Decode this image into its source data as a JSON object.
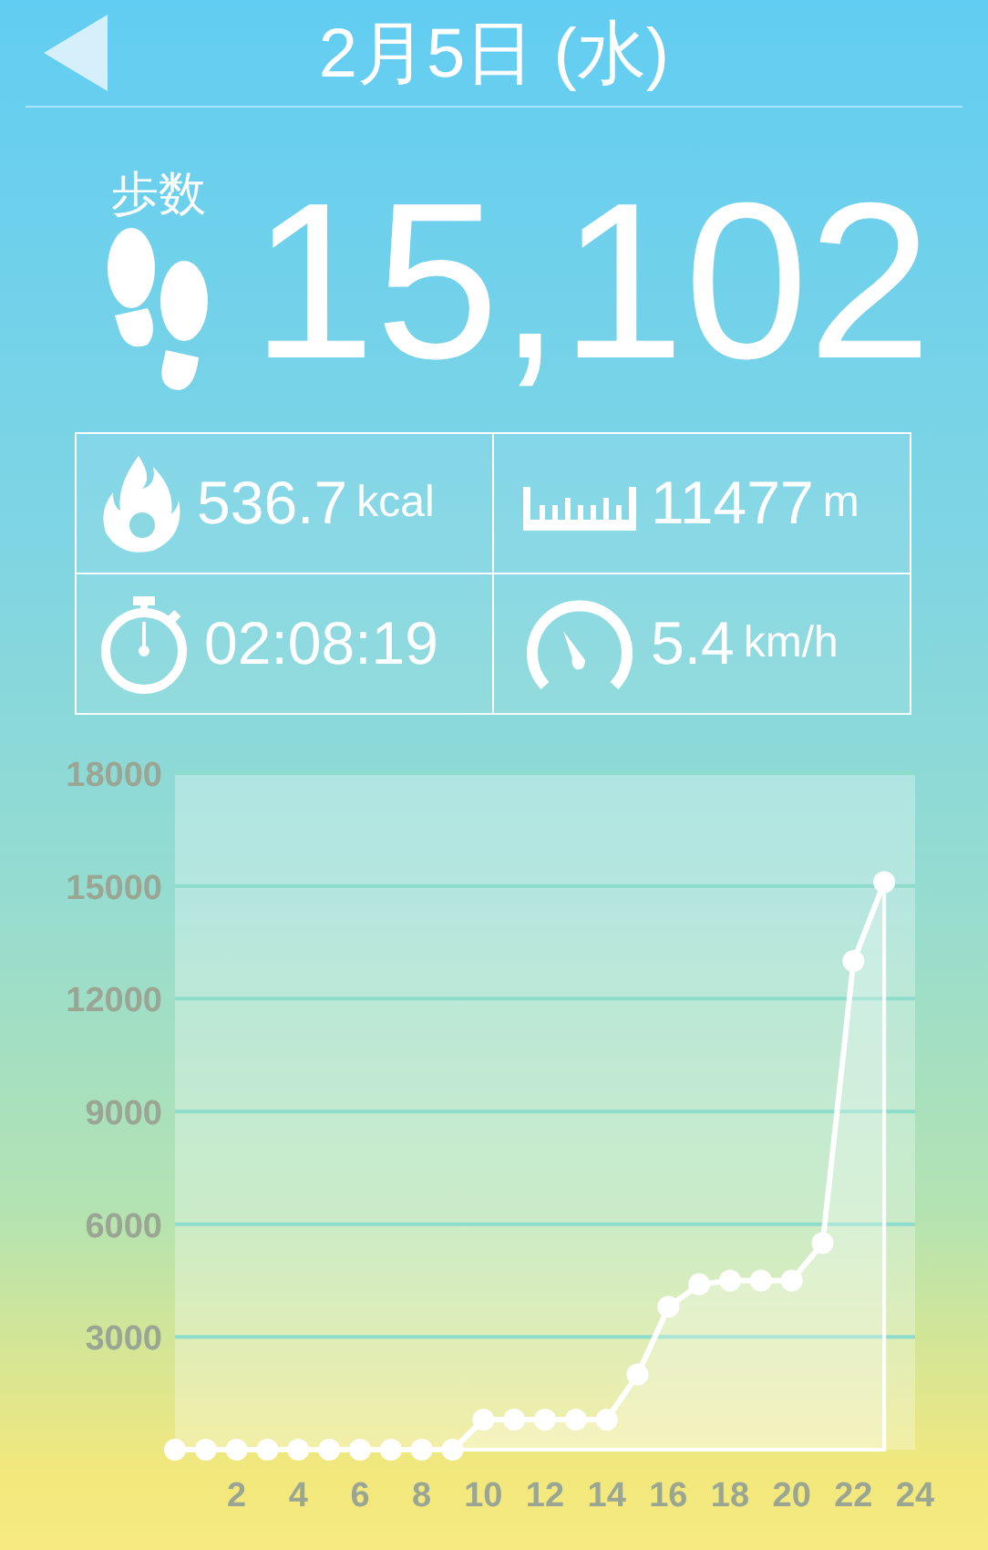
{
  "header": {
    "title": "2月5日 (水)"
  },
  "steps": {
    "label": "歩数",
    "value": "15,102"
  },
  "stats": [
    {
      "kind": "calories",
      "value": "536.7",
      "unit": "kcal"
    },
    {
      "kind": "distance",
      "value": "11477",
      "unit": "m"
    },
    {
      "kind": "time",
      "value": "02:08:19"
    },
    {
      "kind": "speed",
      "value": "5.4",
      "unit": "km/h"
    }
  ],
  "chart_data": {
    "type": "area",
    "grid": true,
    "x": [
      0,
      1,
      2,
      3,
      4,
      5,
      6,
      7,
      8,
      9,
      10,
      11,
      12,
      13,
      14,
      15,
      16,
      17,
      18,
      19,
      20,
      21,
      22,
      23
    ],
    "series": [
      {
        "color": "#ffffff",
        "marker": true,
        "values": [
          0,
          0,
          0,
          0,
          0,
          0,
          0,
          0,
          0,
          0,
          800,
          800,
          800,
          800,
          800,
          2000,
          3800,
          4400,
          4500,
          4500,
          4500,
          5500,
          13000,
          15100
        ]
      }
    ],
    "xlim": [
      0,
      24
    ],
    "ylim": [
      0,
      18000
    ],
    "xticks": [
      2,
      4,
      6,
      8,
      10,
      12,
      14,
      16,
      18,
      20,
      22,
      24
    ],
    "yticks": [
      3000,
      6000,
      9000,
      12000,
      15000,
      18000
    ]
  }
}
